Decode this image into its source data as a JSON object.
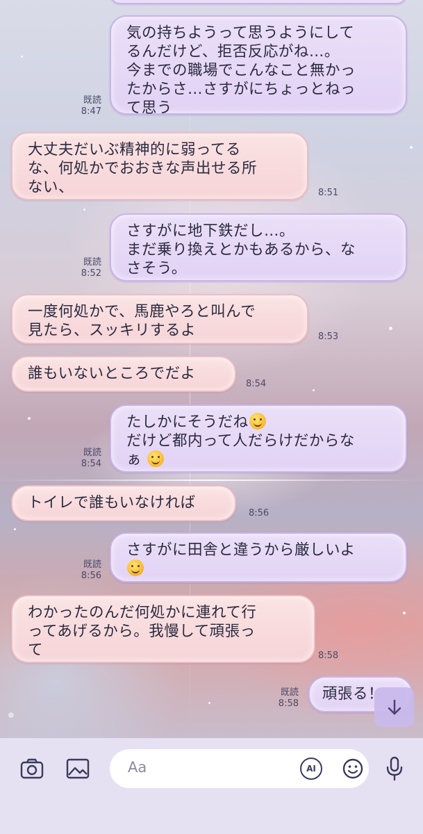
{
  "messages": [
    {
      "side": "sent",
      "lines": [
        "気の持ちようって思うようにして",
        "るんだけど、拒否反応がね…。",
        "今までの職場でこんなこと無かっ",
        "たからさ…さすがにちょっとねっ",
        "て思う"
      ],
      "read": "既読",
      "time": "8:47"
    },
    {
      "side": "recv",
      "lines": [
        "大丈夫だいぶ精神的に弱ってる",
        "な、何処かでおおきな声出せる所",
        "ない、"
      ],
      "time": "8:51"
    },
    {
      "side": "sent",
      "lines": [
        "さすがに地下鉄だし…。",
        "まだ乗り換えとかもあるから、な",
        "さそう。"
      ],
      "read": "既読",
      "time": "8:52"
    },
    {
      "side": "recv",
      "lines": [
        "一度何処かで、馬鹿やろと叫んで",
        "見たら、スッキリするよ"
      ],
      "time": "8:53"
    },
    {
      "side": "recv",
      "lines": [
        "誰もいないところでだよ"
      ],
      "time": "8:54"
    },
    {
      "side": "sent",
      "lines": [
        "たしかにそうだね",
        "だけど都内って人だらけだからな",
        "ぁ"
      ],
      "read": "既読",
      "time": "8:54"
    },
    {
      "side": "recv",
      "lines": [
        "トイレで誰もいなければ"
      ],
      "time": "8:56"
    },
    {
      "side": "sent",
      "lines": [
        "さすがに田舎と違うから厳しいよ",
        ""
      ],
      "read": "既読",
      "time": "8:56"
    },
    {
      "side": "recv",
      "lines": [
        "わかったのんだ何処かに連れて行",
        "ってあげるから。我慢して頑張っ",
        "て"
      ],
      "time": "8:58"
    },
    {
      "side": "sent",
      "lines": [
        "頑張る！"
      ],
      "read": "既読",
      "time": "8:58"
    }
  ],
  "input": {
    "placeholder": "Aa",
    "ai_label": "AI"
  },
  "icons": {
    "camera": "camera-icon",
    "image": "image-icon",
    "ai": "ai-icon",
    "emoji": "emoji-icon",
    "mic": "microphone-icon",
    "scroll_down": "arrow-down-icon"
  },
  "colors": {
    "sent_bubble": "#e4d6f6",
    "recv_bubble": "#f8dadd",
    "accent": "#3a3a5a"
  }
}
